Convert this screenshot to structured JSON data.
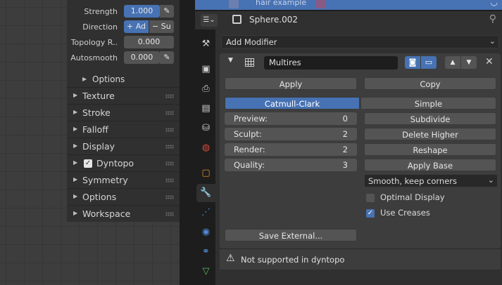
{
  "brush": {
    "strength_label": "Strength",
    "strength_value": "1.000",
    "direction_label": "Direction",
    "direction_add": "+ Ad",
    "direction_sub": "− Su",
    "topology_label": "Topology R..",
    "topology_value": "0.000",
    "autosmooth_label": "Autosmooth",
    "autosmooth_value": "0.000",
    "options_sub": "Options",
    "panels": [
      "Texture",
      "Stroke",
      "Falloff",
      "Display",
      "Dyntopo",
      "Symmetry",
      "Options",
      "Workspace"
    ]
  },
  "outliner": {
    "item": "hair example"
  },
  "properties": {
    "object_name": "Sphere.002",
    "add_modifier": "Add Modifier",
    "modifier_name": "Multires",
    "apply": "Apply",
    "copy": "Copy",
    "catmull": "Catmull-Clark",
    "simple": "Simple",
    "preview_label": "Preview:",
    "preview_value": "0",
    "sculpt_label": "Sculpt:",
    "sculpt_value": "2",
    "render_label": "Render:",
    "render_value": "2",
    "quality_label": "Quality:",
    "quality_value": "3",
    "subdivide": "Subdivide",
    "delete_higher": "Delete Higher",
    "reshape": "Reshape",
    "apply_base": "Apply Base",
    "uv_smooth": "Smooth, keep corners",
    "optimal_display": "Optimal Display",
    "use_creases": "Use Creases",
    "save_external": "Save External...",
    "warning": "Not supported in dyntopo"
  },
  "colors": {
    "accent": "#4772b3",
    "panel": "#303030",
    "field": "#545454"
  }
}
